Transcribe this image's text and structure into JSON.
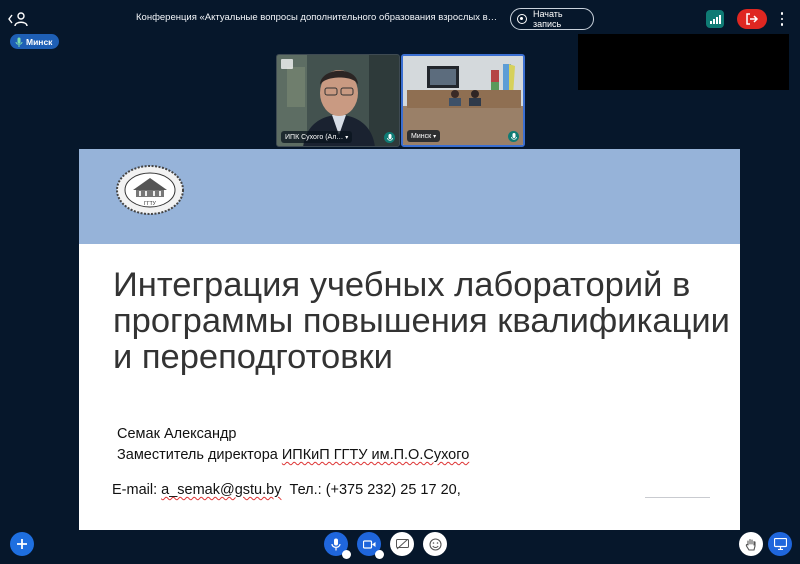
{
  "meeting": {
    "title": "Конференция «Актуальные вопросы дополнительного образования взрослых в энергет…",
    "record_label": "Начать запись"
  },
  "talker": {
    "label": "Минск"
  },
  "tiles": [
    {
      "name": "ИПК Сухого (Ал…"
    },
    {
      "name": "Минск"
    }
  ],
  "slide": {
    "logo_text": "ГГТУ",
    "title": "Интеграция учебных лабораторий в программы повышения квалификации и переподготовки",
    "author": "Семак Александр",
    "position_prefix": "Заместитель директора ",
    "position_org": "ИПКиП ГГТУ им.П.О.Сухого",
    "email_label": "E-mail: ",
    "email": "a_semak@gstu.by",
    "phone": "  Тел.: (+375 232) 25 17 20,"
  },
  "colors": {
    "background": "#06172b",
    "accent": "#1f66dc",
    "leave": "#df2721",
    "connection": "#0f7b74",
    "slide_band": "#96b3d9"
  }
}
